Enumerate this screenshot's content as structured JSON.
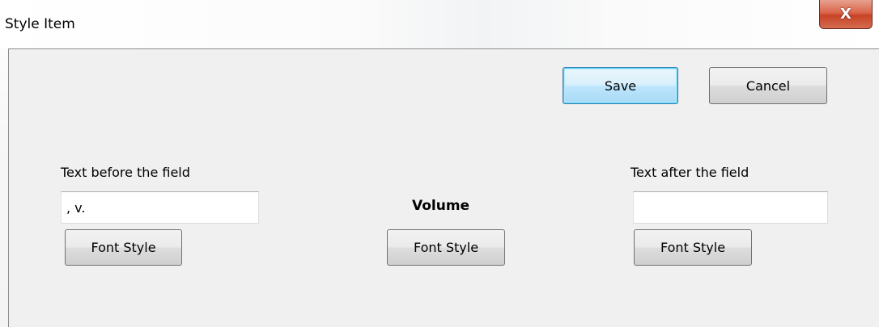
{
  "window": {
    "title": "Style Item",
    "close_glyph": "X"
  },
  "actions": {
    "save_label": "Save",
    "cancel_label": "Cancel"
  },
  "before": {
    "label": "Text before the field",
    "value": ", v.",
    "font_style_label": "Font Style"
  },
  "field": {
    "name": "Volume",
    "font_style_label": "Font Style"
  },
  "after": {
    "label": "Text after the field",
    "value": "",
    "font_style_label": "Font Style"
  }
}
